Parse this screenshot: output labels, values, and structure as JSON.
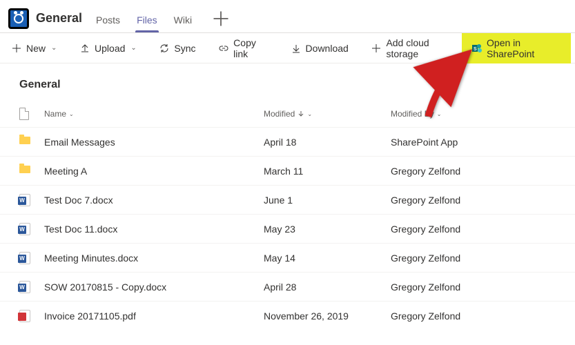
{
  "header": {
    "channel": "General",
    "tabs": [
      "Posts",
      "Files",
      "Wiki"
    ],
    "active_tab": "Files"
  },
  "commands": {
    "new": "New",
    "upload": "Upload",
    "sync": "Sync",
    "copylink": "Copy link",
    "download": "Download",
    "addcloud": "Add cloud storage",
    "sharepoint": "Open in SharePoint"
  },
  "breadcrumb": "General",
  "columns": {
    "name": "Name",
    "modified": "Modified",
    "modifiedby": "Modified By"
  },
  "files": [
    {
      "icon": "folder",
      "name": "Email Messages",
      "modified": "April 18",
      "by": "SharePoint App"
    },
    {
      "icon": "folder",
      "name": "Meeting A",
      "modified": "March 11",
      "by": "Gregory Zelfond"
    },
    {
      "icon": "word",
      "name": "Test Doc 7.docx",
      "modified": "June 1",
      "by": "Gregory Zelfond"
    },
    {
      "icon": "word",
      "name": "Test Doc 11.docx",
      "modified": "May 23",
      "by": "Gregory Zelfond"
    },
    {
      "icon": "word",
      "name": "Meeting Minutes.docx",
      "modified": "May 14",
      "by": "Gregory Zelfond"
    },
    {
      "icon": "word",
      "name": "SOW 20170815 - Copy.docx",
      "modified": "April 28",
      "by": "Gregory Zelfond"
    },
    {
      "icon": "pdf",
      "name": "Invoice 20171105.pdf",
      "modified": "November 26, 2019",
      "by": "Gregory Zelfond"
    }
  ]
}
